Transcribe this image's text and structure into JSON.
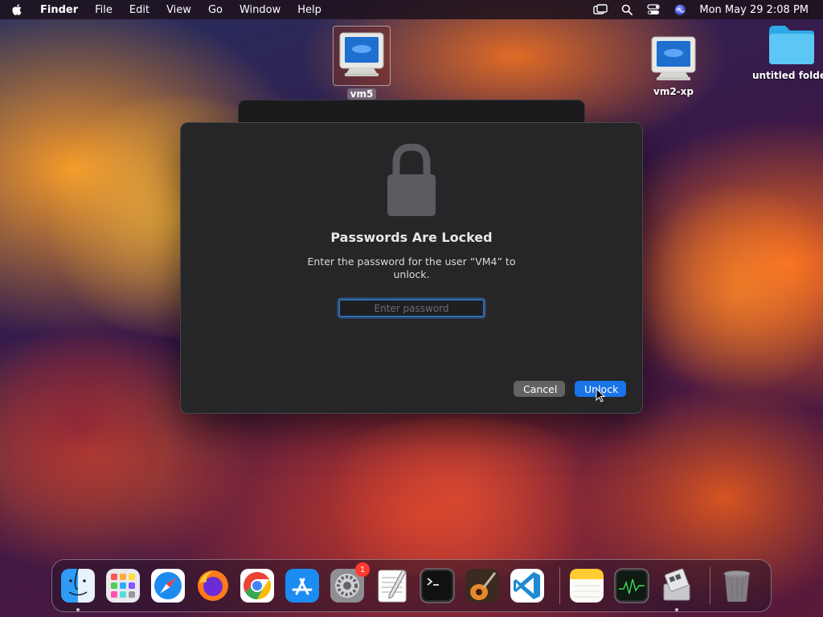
{
  "menubar": {
    "apple_icon": "apple-logo-icon",
    "app_name": "Finder",
    "menus": [
      "File",
      "Edit",
      "View",
      "Go",
      "Window",
      "Help"
    ],
    "status_icons": [
      "screen-mirroring-icon",
      "spotlight-search-icon",
      "control-center-icon",
      "siri-icon"
    ],
    "clock": "Mon May 29  2:08 PM"
  },
  "desktop": {
    "icons": [
      {
        "label": "vm5",
        "icon": "crt-monitor-icon",
        "selected": true
      },
      {
        "label": "vm2-xp",
        "icon": "crt-monitor-icon",
        "selected": false
      },
      {
        "label": "untitled folder",
        "icon": "folder-icon",
        "selected": false
      }
    ]
  },
  "dialog": {
    "icon": "lock-icon",
    "title": "Passwords Are Locked",
    "message": "Enter the password for the user “VM4” to unlock.",
    "password_placeholder": "Enter password",
    "password_value": "",
    "cancel_label": "Cancel",
    "unlock_label": "Unlock"
  },
  "dock": {
    "apps": [
      {
        "name": "Finder",
        "icon": "finder-icon",
        "running": true
      },
      {
        "name": "Launchpad",
        "icon": "launchpad-icon",
        "running": false
      },
      {
        "name": "Safari",
        "icon": "safari-icon",
        "running": false
      },
      {
        "name": "Firefox",
        "icon": "firefox-icon",
        "running": false
      },
      {
        "name": "Chrome",
        "icon": "chrome-icon",
        "running": false
      },
      {
        "name": "App Store",
        "icon": "app-store-icon",
        "running": false
      },
      {
        "name": "System Settings",
        "icon": "system-settings-icon",
        "running": false,
        "badge": "1"
      },
      {
        "name": "TextEdit",
        "icon": "textedit-icon",
        "running": false
      },
      {
        "name": "Terminal",
        "icon": "terminal-icon",
        "running": false
      },
      {
        "name": "GarageBand",
        "icon": "garageband-icon",
        "running": false
      },
      {
        "name": "Visual Studio Code",
        "icon": "vscode-icon",
        "running": false
      }
    ],
    "recent": [
      {
        "name": "Notes",
        "icon": "notes-icon",
        "running": false
      },
      {
        "name": "Activity Monitor",
        "icon": "activity-monitor-icon",
        "running": false
      },
      {
        "name": "Boot Camp Assistant",
        "icon": "boot-camp-icon",
        "running": true
      }
    ],
    "trash": {
      "name": "Trash",
      "icon": "trash-icon"
    }
  },
  "colors": {
    "accent": "#1a73e8",
    "badge": "#ff3b30",
    "dialog_bg": "#262628"
  }
}
